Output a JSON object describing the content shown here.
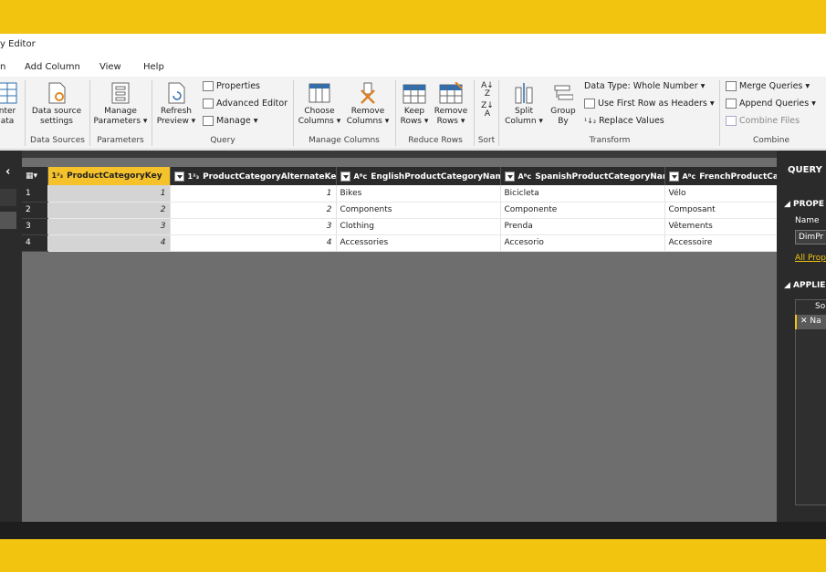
{
  "window": {
    "title": "y Editor"
  },
  "menu": [
    "n",
    "Add Column",
    "View",
    "Help"
  ],
  "ribbon": {
    "enter_data": "nter\nata",
    "data_source_settings": "Data source\nsettings",
    "manage_parameters": "Manage\nParameters ▾",
    "refresh_preview": "Refresh\nPreview ▾",
    "properties": "Properties",
    "advanced_editor": "Advanced Editor",
    "manage": "Manage ▾",
    "choose_columns": "Choose\nColumns ▾",
    "remove_columns": "Remove\nColumns ▾",
    "keep_rows": "Keep\nRows ▾",
    "remove_rows": "Remove\nRows ▾",
    "split_column": "Split\nColumn ▾",
    "group_by": "Group\nBy",
    "data_type": "Data Type: Whole Number ▾",
    "use_first_row": "Use First Row as Headers ▾",
    "replace_values": "Replace Values",
    "merge_queries": "Merge Queries ▾",
    "append_queries": "Append Queries ▾",
    "combine_files": "Combine Files",
    "groups": {
      "data_sources": "Data Sources",
      "parameters": "Parameters",
      "query": "Query",
      "manage_columns": "Manage Columns",
      "reduce_rows": "Reduce Rows",
      "sort": "Sort",
      "transform": "Transform",
      "combine": "Combine"
    }
  },
  "table": {
    "columns": [
      {
        "type": "1²₃",
        "name": "ProductCategoryKey"
      },
      {
        "type": "1²₃",
        "name": "ProductCategoryAlternateKey"
      },
      {
        "type": "Aᴮc",
        "name": "EnglishProductCategoryName"
      },
      {
        "type": "Aᴮc",
        "name": "SpanishProductCategoryName"
      },
      {
        "type": "Aᴮc",
        "name": "FrenchProductCategor"
      }
    ],
    "rows": [
      {
        "n": "1",
        "key": "1",
        "alt": "1",
        "en": "Bikes",
        "es": "Bicicleta",
        "fr": "Vélo"
      },
      {
        "n": "2",
        "key": "2",
        "alt": "2",
        "en": "Components",
        "es": "Componente",
        "fr": "Composant"
      },
      {
        "n": "3",
        "key": "3",
        "alt": "3",
        "en": "Clothing",
        "es": "Prenda",
        "fr": "Vêtements"
      },
      {
        "n": "4",
        "key": "4",
        "alt": "4",
        "en": "Accessories",
        "es": "Accesorio",
        "fr": "Accessoire"
      }
    ]
  },
  "settings": {
    "title": "QUERY",
    "properties_header": "◢ PROPE",
    "name_label": "Name",
    "name_value": "DimPr",
    "all_properties": "All Prop",
    "applied_header": "◢ APPLIE",
    "steps": [
      "So",
      "✕ Na"
    ]
  },
  "colors": {
    "accent": "#f2c40f",
    "dark": "#2b2b2b",
    "grid_bg": "#6e6e6e"
  },
  "icons": [
    "chevron-left-icon",
    "table-icon",
    "dropdown-icon",
    "sort-asc-icon",
    "sort-desc-icon"
  ]
}
